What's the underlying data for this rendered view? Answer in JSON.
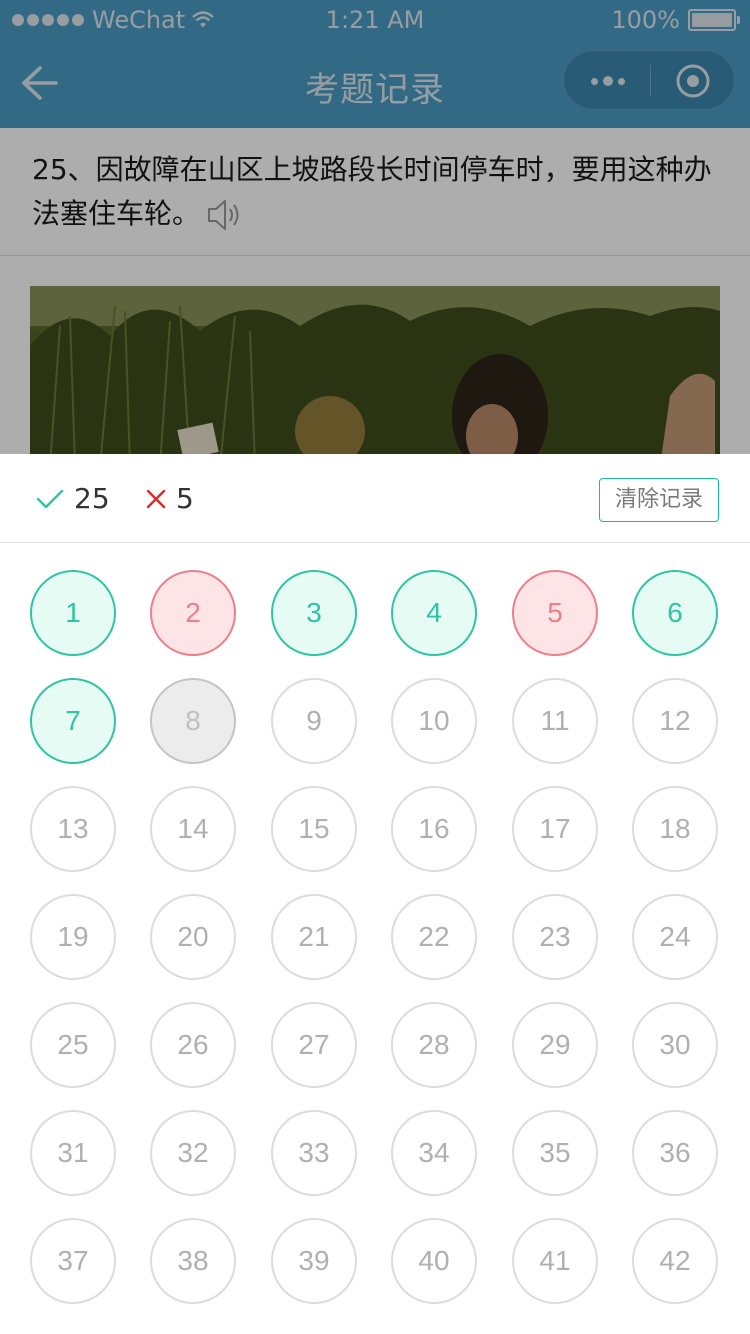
{
  "status_bar": {
    "carrier": "WeChat",
    "time": "1:21 AM",
    "battery_text": "100%",
    "battery_level": 1.0
  },
  "nav": {
    "title": "考题记录",
    "back_icon": "arrow-left-icon",
    "more_icon": "more-dots-icon",
    "close_icon": "target-close-icon"
  },
  "question": {
    "text": "25、因故障在山区上坡路段长时间停车时，要用这种办法塞住车轮。",
    "speaker_icon": "speaker-icon"
  },
  "stats": {
    "correct_count": "25",
    "wrong_count": "5",
    "clear_label": "清除记录"
  },
  "colors": {
    "primary_blue": "#4a9cc4",
    "correct": "#2ec4a4",
    "wrong": "#ec7f87"
  },
  "questions": [
    {
      "label": "1",
      "status": "correct"
    },
    {
      "label": "2",
      "status": "wrong"
    },
    {
      "label": "3",
      "status": "correct"
    },
    {
      "label": "4",
      "status": "correct"
    },
    {
      "label": "5",
      "status": "wrong"
    },
    {
      "label": "6",
      "status": "correct"
    },
    {
      "label": "7",
      "status": "correct"
    },
    {
      "label": "8",
      "status": "current"
    },
    {
      "label": "9",
      "status": "unanswered"
    },
    {
      "label": "10",
      "status": "unanswered"
    },
    {
      "label": "11",
      "status": "unanswered"
    },
    {
      "label": "12",
      "status": "unanswered"
    },
    {
      "label": "13",
      "status": "unanswered"
    },
    {
      "label": "14",
      "status": "unanswered"
    },
    {
      "label": "15",
      "status": "unanswered"
    },
    {
      "label": "16",
      "status": "unanswered"
    },
    {
      "label": "17",
      "status": "unanswered"
    },
    {
      "label": "18",
      "status": "unanswered"
    },
    {
      "label": "19",
      "status": "unanswered"
    },
    {
      "label": "20",
      "status": "unanswered"
    },
    {
      "label": "21",
      "status": "unanswered"
    },
    {
      "label": "22",
      "status": "unanswered"
    },
    {
      "label": "23",
      "status": "unanswered"
    },
    {
      "label": "24",
      "status": "unanswered"
    },
    {
      "label": "25",
      "status": "unanswered"
    },
    {
      "label": "26",
      "status": "unanswered"
    },
    {
      "label": "27",
      "status": "unanswered"
    },
    {
      "label": "28",
      "status": "unanswered"
    },
    {
      "label": "29",
      "status": "unanswered"
    },
    {
      "label": "30",
      "status": "unanswered"
    },
    {
      "label": "31",
      "status": "unanswered"
    },
    {
      "label": "32",
      "status": "unanswered"
    },
    {
      "label": "33",
      "status": "unanswered"
    },
    {
      "label": "34",
      "status": "unanswered"
    },
    {
      "label": "35",
      "status": "unanswered"
    },
    {
      "label": "36",
      "status": "unanswered"
    },
    {
      "label": "37",
      "status": "unanswered"
    },
    {
      "label": "38",
      "status": "unanswered"
    },
    {
      "label": "39",
      "status": "unanswered"
    },
    {
      "label": "40",
      "status": "unanswered"
    },
    {
      "label": "41",
      "status": "unanswered"
    },
    {
      "label": "42",
      "status": "unanswered"
    }
  ]
}
